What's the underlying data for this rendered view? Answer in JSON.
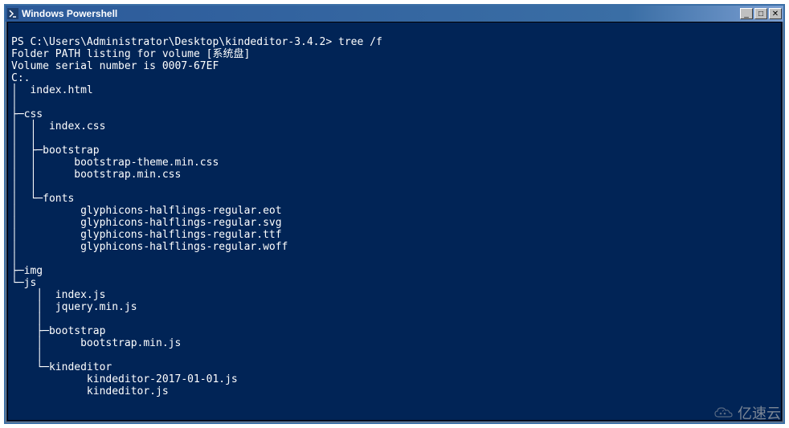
{
  "window": {
    "title": "Windows Powershell",
    "buttons": {
      "minimize": "_",
      "maximize": "▢",
      "close": "✕"
    }
  },
  "console": {
    "prompt_prefix": "PS ",
    "prompt_path": "C:\\Users\\Administrator\\Desktop\\kindeditor-3.4.2>",
    "command": "tree /f",
    "lines": [
      "Folder PATH listing for volume [系统盘]",
      "Volume serial number is 0007-67EF",
      "C:.",
      "│  index.html",
      "│",
      "├─css",
      "│  │  index.css",
      "│  │",
      "│  ├─bootstrap",
      "│  │      bootstrap-theme.min.css",
      "│  │      bootstrap.min.css",
      "│  │",
      "│  └─fonts",
      "│          glyphicons-halflings-regular.eot",
      "│          glyphicons-halflings-regular.svg",
      "│          glyphicons-halflings-regular.ttf",
      "│          glyphicons-halflings-regular.woff",
      "│",
      "├─img",
      "└─js",
      "    │  index.js",
      "    │  jquery.min.js",
      "    │",
      "    ├─bootstrap",
      "    │      bootstrap.min.js",
      "    │",
      "    └─kindeditor",
      "            kindeditor-2017-01-01.js",
      "            kindeditor.js"
    ]
  },
  "watermark": {
    "text": "亿速云"
  }
}
